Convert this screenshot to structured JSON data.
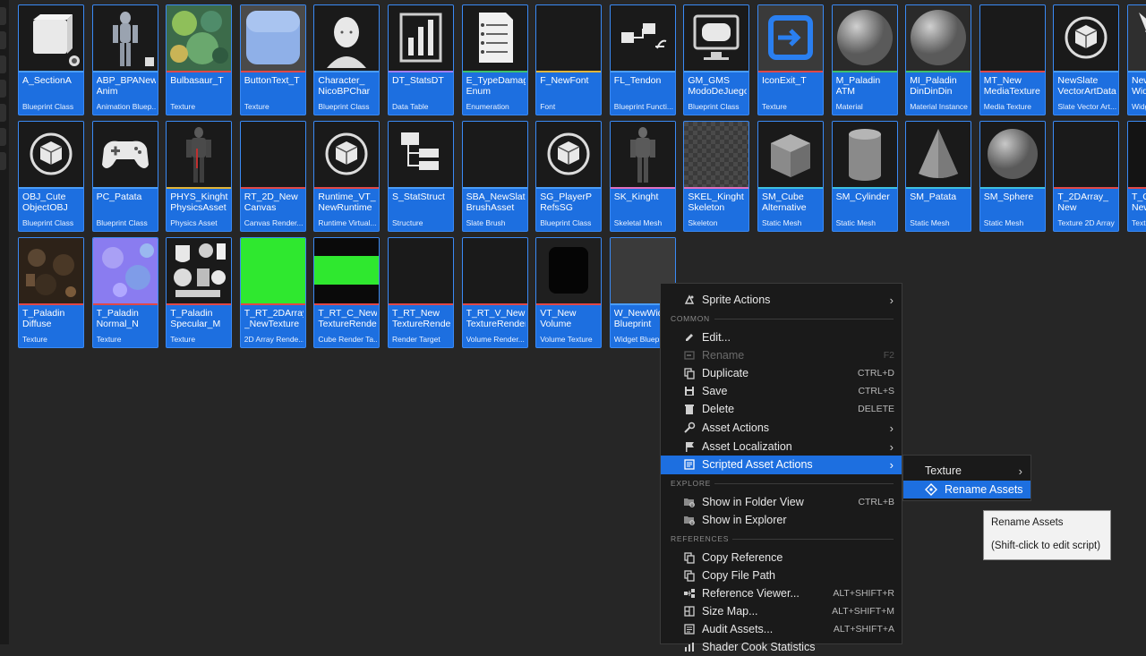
{
  "assets": [
    {
      "name": "A_SectionA",
      "type": "Blueprint Class",
      "thumb": "cube",
      "strip": "#4a9df8"
    },
    {
      "name": "ABP_BPANew\nAnim",
      "type": "Animation Bluep...",
      "thumb": "mannequin",
      "strip": "#4a9df8"
    },
    {
      "name": "Bulbasaur_T",
      "type": "Texture",
      "thumb": "bulbasaur",
      "strip": "#e04848"
    },
    {
      "name": "ButtonText_T",
      "type": "Texture",
      "thumb": "button",
      "strip": "#e04848"
    },
    {
      "name": "Character_\nNicoBPChar",
      "type": "Blueprint Class",
      "thumb": "face",
      "strip": "#4a9df8"
    },
    {
      "name": "DT_StatsDT",
      "type": "Data Table",
      "thumb": "barchart",
      "strip": "#a07cf0"
    },
    {
      "name": "E_TypeDamag\nEnum",
      "type": "Enumeration",
      "thumb": "document",
      "strip": "#3ec06a"
    },
    {
      "name": "F_NewFont",
      "type": "Font",
      "thumb": "black",
      "strip": "#e0b43a"
    },
    {
      "name": "FL_Tendon",
      "type": "Blueprint Functi...",
      "thumb": "function",
      "strip": "#4a9df8"
    },
    {
      "name": "GM_GMS\nModoDeJuego",
      "type": "Blueprint Class",
      "thumb": "gamemode",
      "strip": "#4a9df8"
    },
    {
      "name": "IconExit_T",
      "type": "Texture",
      "thumb": "exit",
      "strip": "#e04848"
    },
    {
      "name": "M_Paladin\nATM",
      "type": "Material",
      "thumb": "sphere",
      "strip": "#3ec06a"
    },
    {
      "name": "MI_Paladin\nDinDinDin",
      "type": "Material Instance",
      "thumb": "sphere",
      "strip": "#3ec06a"
    },
    {
      "name": "MT_New\nMediaTexture",
      "type": "Media Texture",
      "thumb": "black",
      "strip": "#e04848"
    },
    {
      "name": "NewSlate\nVectorArtData",
      "type": "Slate Vector Art...",
      "thumb": "cubecircle",
      "strip": "#4a9df8"
    },
    {
      "name": "NewWidg\nWidget",
      "type": "Widget",
      "thumb": "partial",
      "strip": "#4a9df8"
    },
    {
      "name": "OBJ_Cute\nObjectOBJ",
      "type": "Blueprint Class",
      "thumb": "cubecircle",
      "strip": "#4a9df8"
    },
    {
      "name": "PC_Patata",
      "type": "Blueprint Class",
      "thumb": "gamepad",
      "strip": "#4a9df8"
    },
    {
      "name": "PHYS_Kinght\nPhysicsAsset",
      "type": "Physics Asset",
      "thumb": "knight",
      "strip": "#e0b43a"
    },
    {
      "name": "RT_2D_New\nCanvas",
      "type": "Canvas Render...",
      "thumb": "black",
      "strip": "#e04848"
    },
    {
      "name": "Runtime_VT_\nNewRuntime",
      "type": "Runtime Virtual...",
      "thumb": "cubecircle",
      "strip": "#e04848"
    },
    {
      "name": "S_StatStruct",
      "type": "Structure",
      "thumb": "struct",
      "strip": "#4a9df8"
    },
    {
      "name": "SBA_NewSlate\nBrushAsset",
      "type": "Slate Brush",
      "thumb": "black",
      "strip": "#4a9df8"
    },
    {
      "name": "SG_PlayerP\nRefsSG",
      "type": "Blueprint Class",
      "thumb": "cubecircle",
      "strip": "#4a9df8"
    },
    {
      "name": "SK_Kinght",
      "type": "Skeletal Mesh",
      "thumb": "knight2",
      "strip": "#e070c0"
    },
    {
      "name": "SKEL_Kinght\nSkeleton",
      "type": "Skeleton",
      "thumb": "checker",
      "strip": "#e070c0"
    },
    {
      "name": "SM_Cube\nAlternative",
      "type": "Static Mesh",
      "thumb": "cube3d",
      "strip": "#3ec0e0"
    },
    {
      "name": "SM_Cylinder",
      "type": "Static Mesh",
      "thumb": "cylinder",
      "strip": "#3ec0e0"
    },
    {
      "name": "SM_Patata",
      "type": "Static Mesh",
      "thumb": "cone",
      "strip": "#3ec0e0"
    },
    {
      "name": "SM_Sphere",
      "type": "Static Mesh",
      "thumb": "sphere3d",
      "strip": "#3ec0e0"
    },
    {
      "name": "T_2DArray_\nNew",
      "type": "Texture 2D Array",
      "thumb": "black",
      "strip": "#e04848"
    },
    {
      "name": "T_C\nNew",
      "type": "Texture",
      "thumb": "partialdark",
      "strip": "#e04848"
    },
    {
      "name": "T_Paladin\nDiffuse",
      "type": "Texture",
      "thumb": "diffuse",
      "strip": "#e04848"
    },
    {
      "name": "T_Paladin\nNormal_N",
      "type": "Texture",
      "thumb": "normal",
      "strip": "#e04848"
    },
    {
      "name": "T_Paladin\nSpecular_M",
      "type": "Texture",
      "thumb": "specular",
      "strip": "#e04848"
    },
    {
      "name": "T_RT_2DArray\n_NewTexture",
      "type": "2D Array Rende...",
      "thumb": "green",
      "strip": "#e04848"
    },
    {
      "name": "T_RT_C_New\nTextureRender",
      "type": "Cube Render Ta...",
      "thumb": "greenbar",
      "strip": "#e04848"
    },
    {
      "name": "T_RT_New\nTextureRender",
      "type": "Render Target",
      "thumb": "black",
      "strip": "#e04848"
    },
    {
      "name": "T_RT_V_New\nTextureRender",
      "type": "Volume Render...",
      "thumb": "black",
      "strip": "#e04848"
    },
    {
      "name": "VT_New\nVolume",
      "type": "Volume Texture",
      "thumb": "volume",
      "strip": "#e04848"
    },
    {
      "name": "W_NewWidg\nBlueprint",
      "type": "Widget Bluepri",
      "thumb": "gray",
      "strip": "#4a9df8"
    }
  ],
  "context_menu": {
    "sprite_actions": "Sprite Actions",
    "section_common": "COMMON",
    "edit": "Edit...",
    "rename": "Rename",
    "rename_shortcut": "F2",
    "duplicate": "Duplicate",
    "duplicate_shortcut": "CTRL+D",
    "save": "Save",
    "save_shortcut": "CTRL+S",
    "delete": "Delete",
    "delete_shortcut": "DELETE",
    "asset_actions": "Asset Actions",
    "asset_localization": "Asset Localization",
    "scripted_asset_actions": "Scripted Asset Actions",
    "section_explore": "EXPLORE",
    "show_in_folder_view": "Show in Folder View",
    "show_in_folder_view_shortcut": "CTRL+B",
    "show_in_explorer": "Show in Explorer",
    "section_references": "REFERENCES",
    "copy_reference": "Copy Reference",
    "copy_file_path": "Copy File Path",
    "reference_viewer": "Reference Viewer...",
    "reference_viewer_shortcut": "ALT+SHIFT+R",
    "size_map": "Size Map...",
    "size_map_shortcut": "ALT+SHIFT+M",
    "audit_assets": "Audit Assets...",
    "audit_assets_shortcut": "ALT+SHIFT+A",
    "shader_cook": "Shader Cook Statistics"
  },
  "submenu": {
    "texture": "Texture",
    "rename_assets": "Rename Assets"
  },
  "tooltip": {
    "title": "Rename Assets",
    "hint": "(Shift-click to edit script)"
  },
  "colors": {
    "accent": "#1d6fe0",
    "tile_border": "#3a8af5",
    "background": "#262626",
    "menu_bg": "#1a1a1a"
  }
}
